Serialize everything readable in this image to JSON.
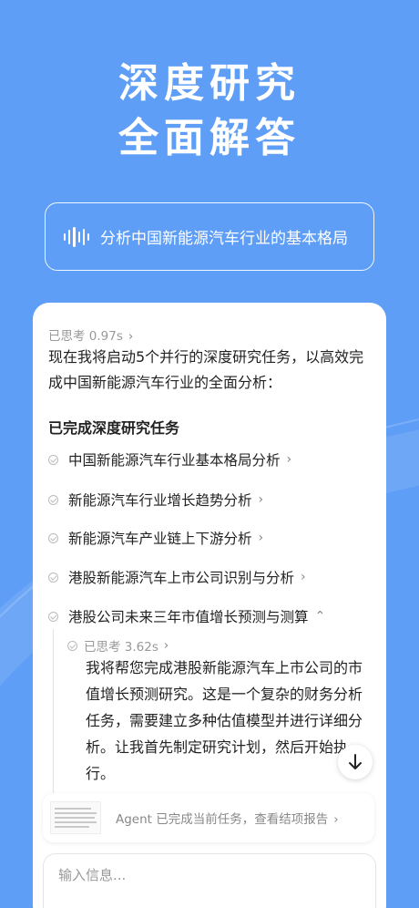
{
  "hero": {
    "line1": "深度研究",
    "line2": "全面解答"
  },
  "query": {
    "text": "分析中国新能源汽车行业的基本格局",
    "icon": "voice-wave-icon"
  },
  "answer": {
    "thought_label": "已思考 0.97s",
    "intro": "现在我将启动5个并行的深度研究任务，以高效完成中国新能源汽车行业的全面分析：",
    "section_title": "已完成深度研究任务",
    "tasks": [
      {
        "label": "中国新能源汽车行业基本格局分析",
        "chevron": "›"
      },
      {
        "label": "新能源汽车行业增长趋势分析",
        "chevron": "›"
      },
      {
        "label": "新能源汽车产业链上下游分析",
        "chevron": "›"
      },
      {
        "label": "港股新能源汽车上市公司识别与分析",
        "chevron": "›"
      },
      {
        "label": "港股公司未来三年市值增长预测与测算",
        "chevron": "⌃"
      }
    ],
    "sub_thought_label": "已思考 3.62s",
    "sub_text": "我将帮您完成港股新能源汽车上市公司的市值增长预测研究。这是一个复杂的财务分析任务，需要建立多种估值模型并进行详细分析。让我首先制定研究计划，然后开始执行。"
  },
  "report": {
    "text": "Agent 已完成当前任务，查看结项报告",
    "chevron": "›"
  },
  "input": {
    "placeholder": "输入信息..."
  },
  "colors": {
    "background": "#5f9ef6",
    "card": "#ffffff",
    "muted": "#999999"
  }
}
